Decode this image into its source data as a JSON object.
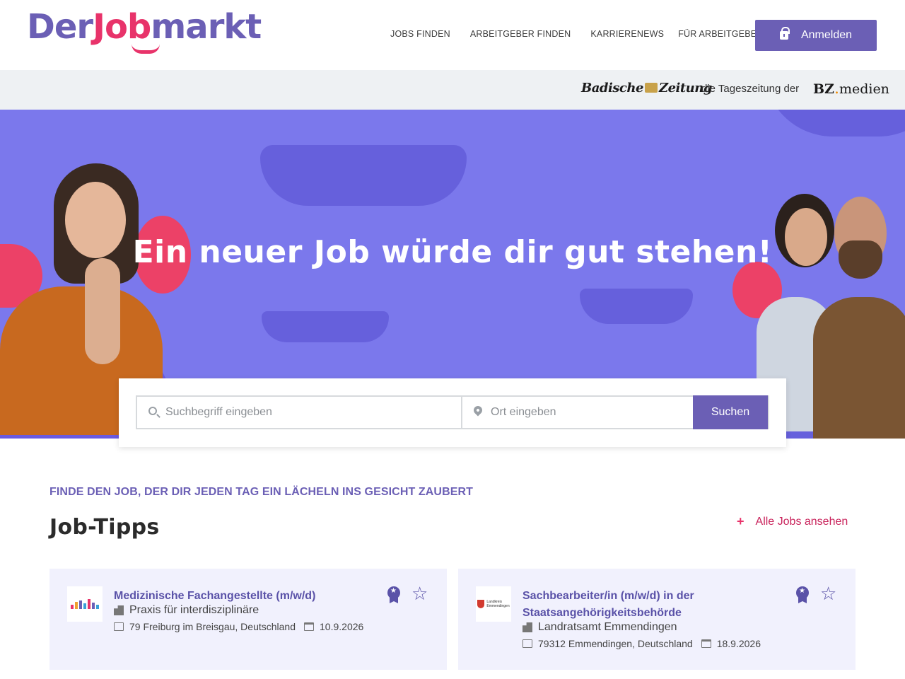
{
  "header": {
    "logo": {
      "part1": "Der",
      "part2": "Job",
      "part3": "markt"
    },
    "nav": [
      "JOBS FINDEN",
      "ARBEITGEBER FINDEN",
      "KARRIERENEWS",
      "FÜR ARBEITGEBER"
    ],
    "login_label": "Anmelden"
  },
  "partner": {
    "bz_part1": "Badische",
    "bz_part2": "Zeitung",
    "tagline": "die Tageszeitung der",
    "bzmedien_part1": "BZ",
    "bzmedien_part2": "medien"
  },
  "hero": {
    "title": "Ein neuer Job würde dir gut stehen!"
  },
  "search": {
    "keyword_placeholder": "Suchbegriff eingeben",
    "location_placeholder": "Ort eingeben",
    "button_label": "Suchen"
  },
  "content": {
    "eyebrow": "FINDE DEN JOB, DER DIR JEDEN TAG EIN LÄCHELN INS GESICHT ZAUBERT",
    "section_title": "Job-Tipps",
    "all_jobs_label": "Alle Jobs ansehen"
  },
  "jobs": [
    {
      "title": "Medizinische Fachangestellte (m/w/d)",
      "company": "Praxis für interdisziplinäre",
      "location": "79 Freiburg im Breisgau, Deutschland",
      "date": "10.9.2026"
    },
    {
      "title": "Sachbearbeiter/in (m/w/d) in der Staatsangehörigkeitsbehörde",
      "company": "Landratsamt Emmendingen",
      "location": "79312 Emmendingen, Deutschland",
      "date": "18.9.2026",
      "logo_text_line1": "Landkreis",
      "logo_text_line2": "Emmendingen"
    }
  ],
  "colors": {
    "brand_purple": "#6b5fb5",
    "brand_pink": "#e8336a",
    "hero_bg": "#7b78ec",
    "card_bg": "#f1f1fd"
  },
  "icons": [
    "lock-icon",
    "search-icon",
    "location-pin-icon",
    "plus-icon",
    "building-icon",
    "map-icon",
    "calendar-icon",
    "award-badge-icon",
    "star-outline-icon",
    "chevron-down-icon"
  ]
}
